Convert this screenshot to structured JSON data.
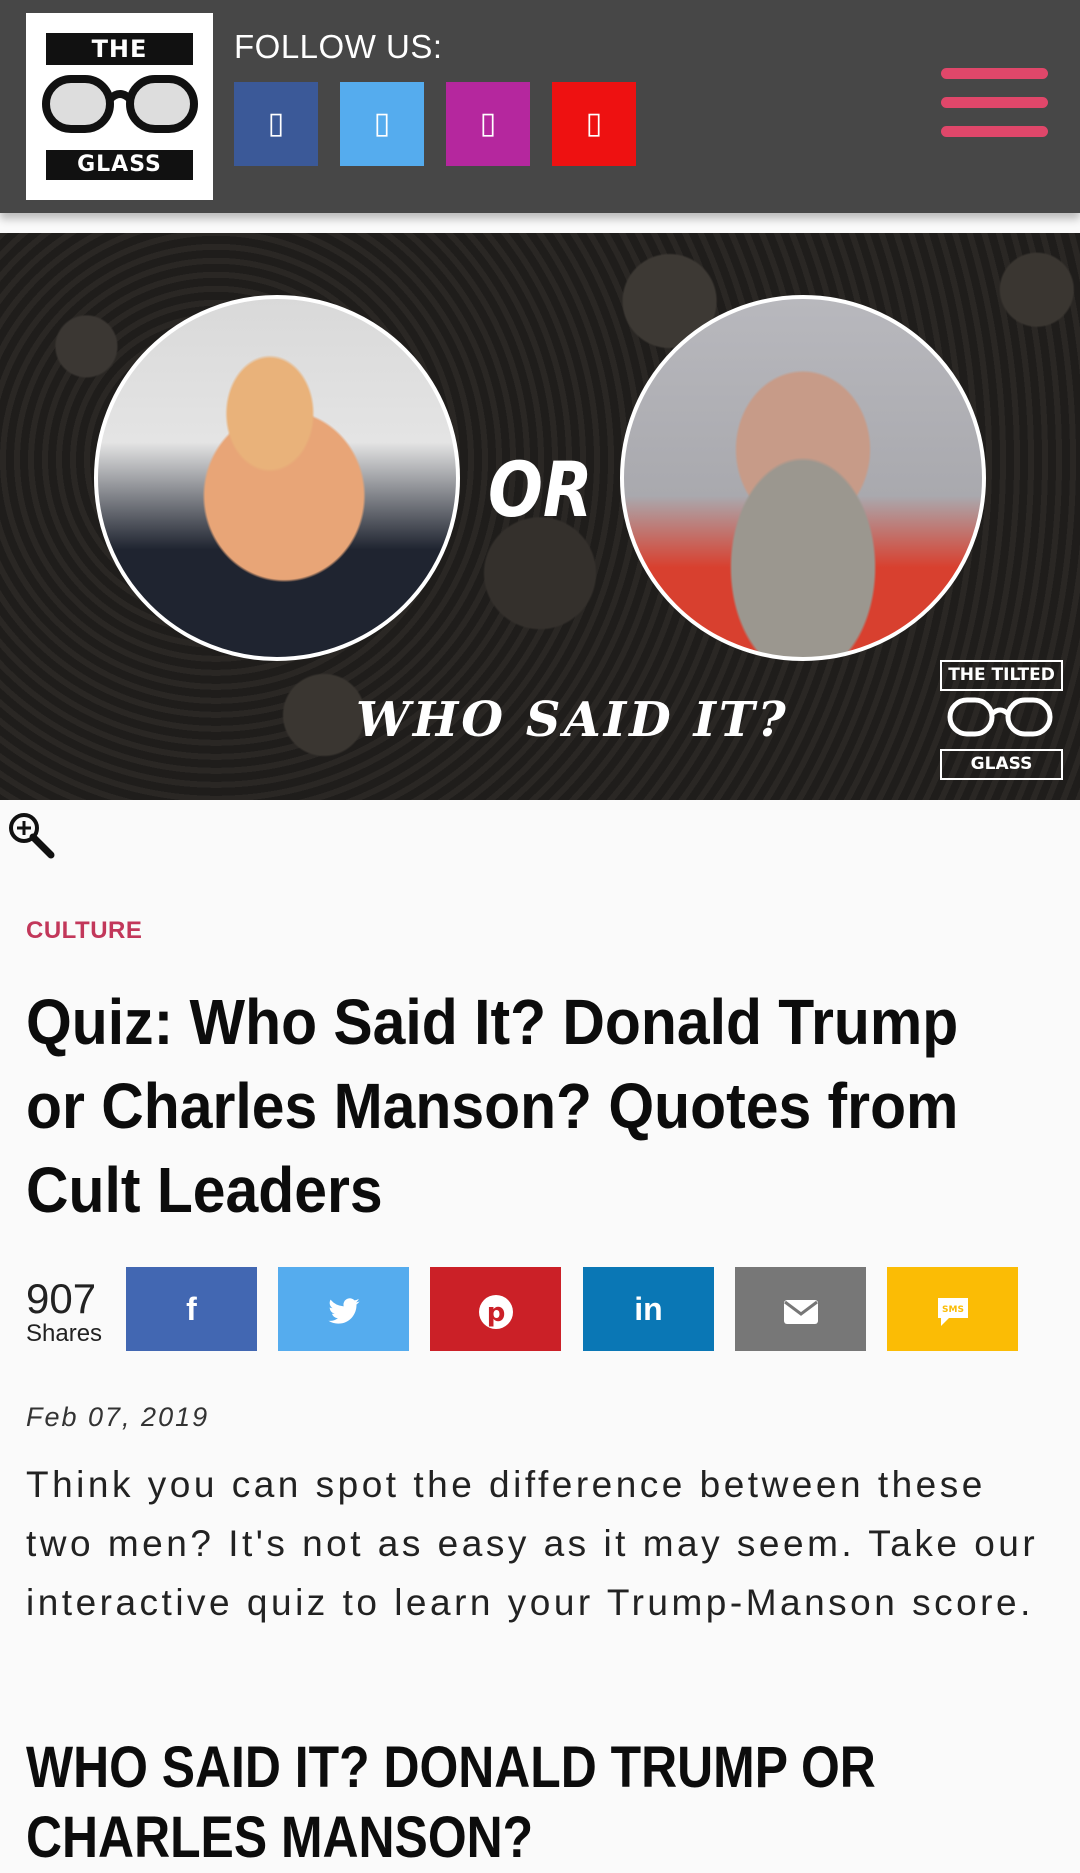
{
  "header": {
    "logo": {
      "top": "THE TILTED",
      "bottom": "GLASS"
    },
    "follow_label": "FOLLOW US:",
    "social": [
      {
        "name": "facebook",
        "glyph": "f",
        "color": "#3b5998"
      },
      {
        "name": "twitter",
        "glyph": "t",
        "color": "#55acee"
      },
      {
        "name": "instagram",
        "glyph": "◎",
        "color": "#b5279e"
      },
      {
        "name": "youtube",
        "glyph": "▶",
        "color": "#ee1111"
      }
    ],
    "menu_color": "#e0476a"
  },
  "hero": {
    "or_text": "OR",
    "caption": "WHO SAID IT?",
    "logo": {
      "top": "THE TILTED",
      "bottom": "GLASS"
    }
  },
  "article": {
    "category": "CULTURE",
    "title": "Quiz: Who Said It? Donald Trump or Charles Manson? Quotes from Cult Leaders",
    "shares": {
      "count": "907",
      "label": "Shares"
    },
    "share_buttons": [
      {
        "name": "facebook",
        "label": "f",
        "color": "#4267b2"
      },
      {
        "name": "twitter",
        "label": "🐦",
        "color": "#55acee"
      },
      {
        "name": "pinterest",
        "label": "P",
        "color": "#cb2027"
      },
      {
        "name": "linkedin",
        "label": "in",
        "color": "#0a77b5"
      },
      {
        "name": "email",
        "label": "✉",
        "color": "#777777"
      },
      {
        "name": "sms",
        "label": "SMS",
        "color": "#fbbc05"
      }
    ],
    "date": "Feb 07, 2019",
    "lede": "Think you can spot the difference between these two men? It's not as easy as it may seem. Take our interactive quiz to learn your Trump-Manson score.",
    "subheading": "WHO SAID IT? DONALD TRUMP OR CHARLES MANSON?"
  }
}
